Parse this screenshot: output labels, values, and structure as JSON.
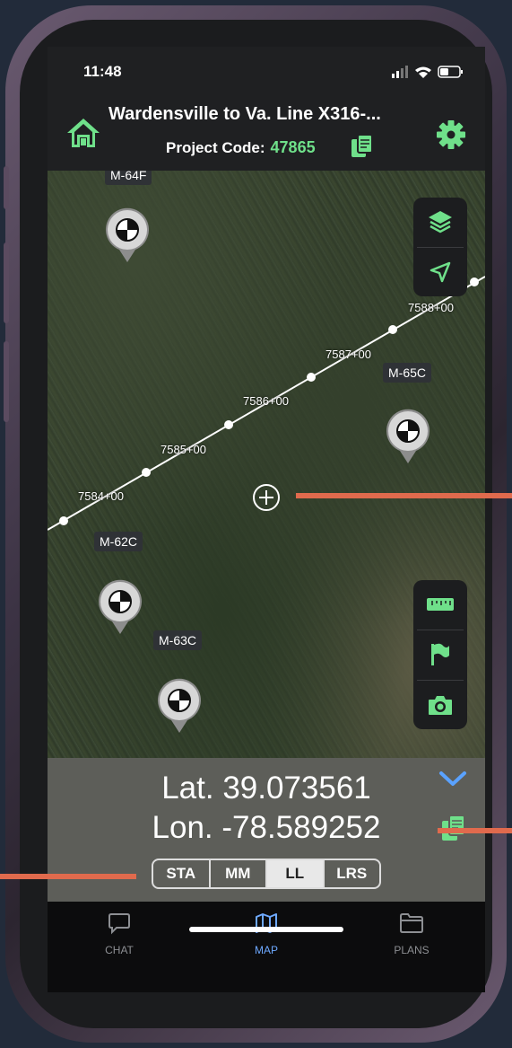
{
  "status_bar": {
    "time": "11:48"
  },
  "header": {
    "title": "Wardensville to Va. Line X316-...",
    "project_label": "Project Code:",
    "project_code": "47865"
  },
  "map": {
    "stations": [
      "7584+00",
      "7585+00",
      "7586+00",
      "7587+00",
      "7588+00"
    ],
    "markers": [
      {
        "label": "M-64F"
      },
      {
        "label": "M-65C"
      },
      {
        "label": "M-62C"
      },
      {
        "label": "M-63C"
      }
    ],
    "top_tools": [
      "layers-icon",
      "navigation-arrow-icon"
    ],
    "bottom_tools": [
      "ruler-icon",
      "flag-icon",
      "camera-icon"
    ]
  },
  "coords": {
    "lat": "Lat. 39.073561",
    "lon": "Lon. -78.589252",
    "modes": [
      "STA",
      "MM",
      "LL",
      "LRS"
    ],
    "active_mode": "LL"
  },
  "tabs": [
    {
      "label": "CHAT",
      "icon": "chat-icon"
    },
    {
      "label": "MAP",
      "icon": "map-icon"
    },
    {
      "label": "PLANS",
      "icon": "folder-icon"
    }
  ],
  "colors": {
    "accent_green": "#6fe08a",
    "active_tab_blue": "#6ea9ff",
    "callout_orange": "#e06a4d"
  }
}
